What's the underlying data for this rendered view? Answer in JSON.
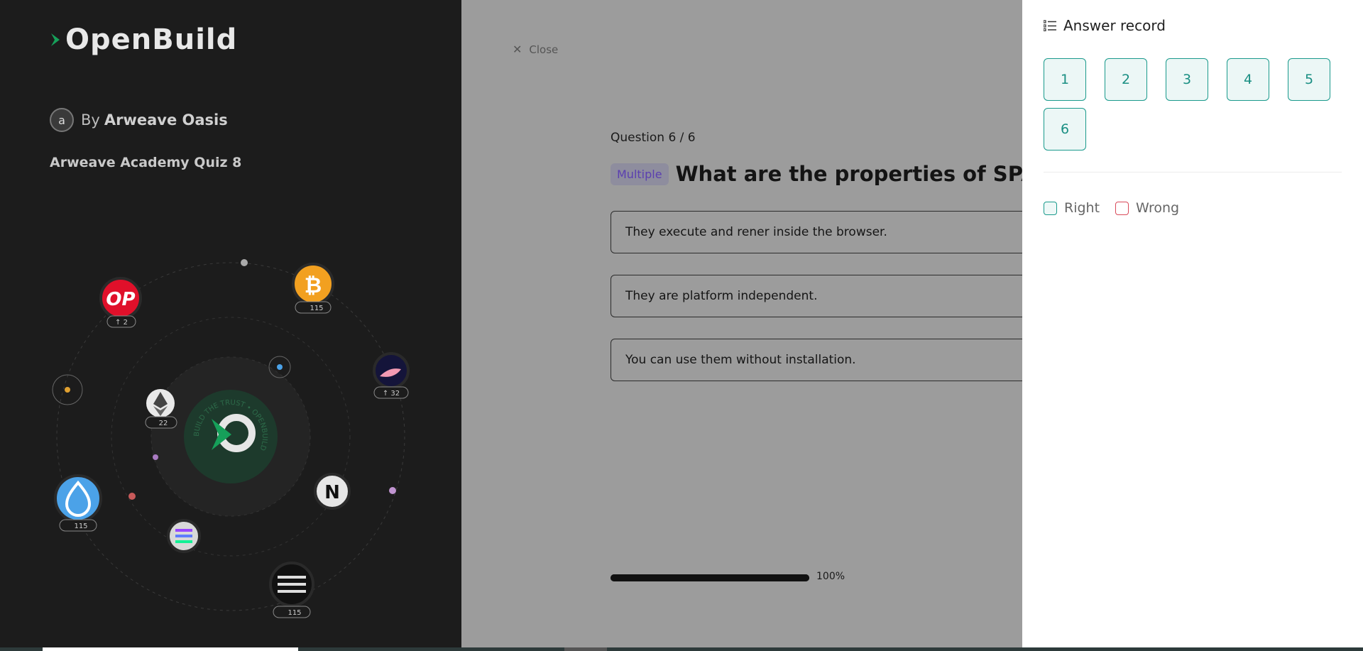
{
  "brand": {
    "logo_text": "OpenBuild"
  },
  "creator": {
    "by": "By",
    "name": "Arweave Oasis"
  },
  "quiz": {
    "title": "Arweave Academy Quiz 8"
  },
  "orbit_badges": {
    "op": "↑ 2",
    "btc": "115",
    "starknet": "↑ 32",
    "eth": "22",
    "sui": "115",
    "aptos": "115"
  },
  "orbit_center_text": "BUILD THE TRUST • OPENBUILD",
  "close": {
    "label": "Close"
  },
  "question": {
    "counter": "Question 6 / 6",
    "type_tag": "Multiple",
    "text": "What are the properties of SPAs?",
    "options": [
      "They execute and rener inside the browser.",
      "They are platform independent.",
      "You can use them without installation."
    ]
  },
  "progress": {
    "value": 1.0,
    "label": "100%"
  },
  "answer_record": {
    "title": "Answer record",
    "items": [
      "1",
      "2",
      "3",
      "4",
      "5",
      "6"
    ],
    "legend": {
      "right": "Right",
      "wrong": "Wrong"
    }
  },
  "colors": {
    "teal": "#1a9a8c",
    "wrong_red": "#d94a5a",
    "tag_purple": "#5b3fb0",
    "openbuild_green": "#16a05a"
  }
}
